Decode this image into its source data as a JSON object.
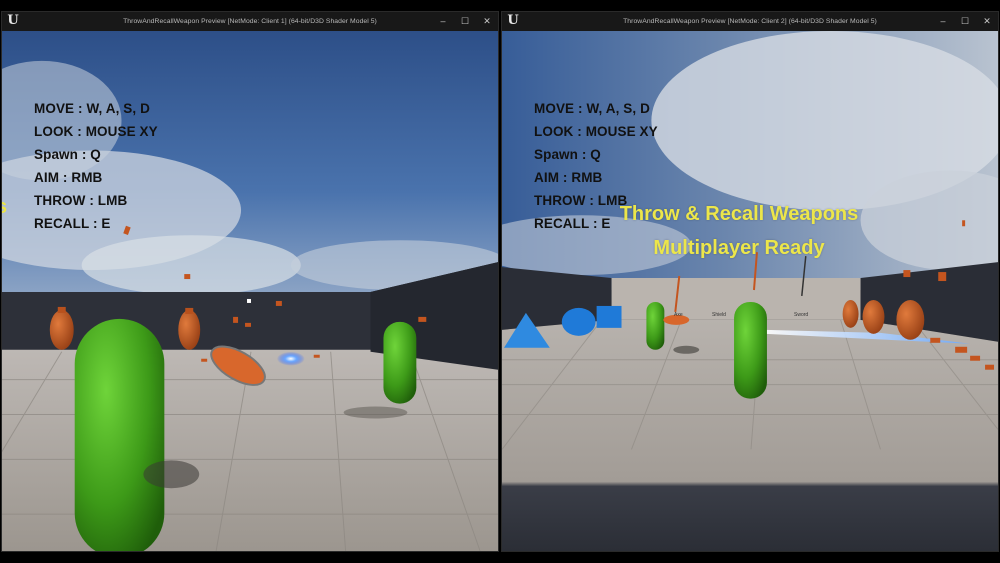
{
  "windows": [
    {
      "id": "client1",
      "title": "ThrowAndRecallWeapon Preview [NetMode: Client 1]  (64-bit/D3D Shader Model 5)",
      "controls": {
        "minimize": "–",
        "maximize": "☐",
        "close": "✕"
      },
      "hud_controls": [
        "MOVE : W, A, S, D",
        "LOOK : MOUSE XY",
        "Spawn : Q",
        "AIM : RMB",
        "THROW : LMB",
        "RECALL : E"
      ],
      "edge_banner_fragment": "s"
    },
    {
      "id": "client2",
      "title": "ThrowAndRecallWeapon Preview [NetMode: Client 2]  (64-bit/D3D Shader Model 5)",
      "controls": {
        "minimize": "–",
        "maximize": "☐",
        "close": "✕"
      },
      "hud_controls": [
        "MOVE : W, A, S, D",
        "LOOK : MOUSE XY",
        "Spawn : Q",
        "AIM : RMB",
        "THROW : LMB",
        "RECALL : E"
      ],
      "banner": [
        "Throw & Recall Weapons",
        "Multiplayer Ready"
      ],
      "weapon_labels": [
        "Axe",
        "Shield",
        "Sword"
      ]
    }
  ],
  "icons": {
    "app_logo": "unreal-engine-logo"
  },
  "colors": {
    "banner_yellow": "#ece64a",
    "capsule_green": "#3fa51c",
    "pot_orange": "#c4551f",
    "sky_blue": "#3c64a0",
    "shape_blue": "#1f7ad8"
  }
}
